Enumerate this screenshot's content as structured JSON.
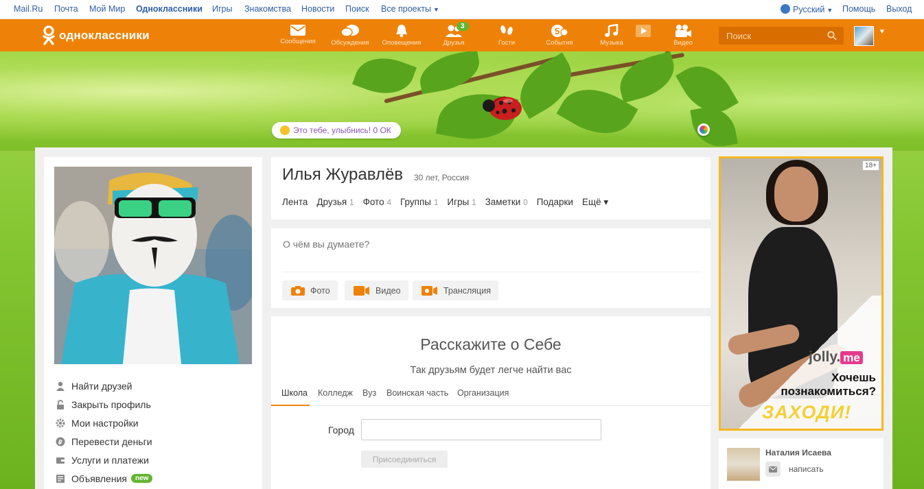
{
  "portal": {
    "links": [
      "Mail.Ru",
      "Почта",
      "Мой Мир",
      "Одноклассники",
      "Игры",
      "Знакомства",
      "Новости",
      "Поиск",
      "Все проекты"
    ],
    "language": "Русский",
    "help": "Помощь",
    "logout": "Выход"
  },
  "toolbar": {
    "logo_text": "одноклассники",
    "nav": [
      {
        "label": "Сообщения",
        "icon": "envelope-icon"
      },
      {
        "label": "Обсуждения",
        "icon": "chat-bubbles-icon"
      },
      {
        "label": "Оповещения",
        "icon": "bell-icon"
      },
      {
        "label": "Друзья",
        "icon": "friends-icon",
        "badge": "3"
      },
      {
        "label": "Гости",
        "icon": "footprints-icon"
      },
      {
        "label": "События",
        "icon": "events-icon"
      },
      {
        "label": "Музыка",
        "icon": "music-note-icon"
      },
      {
        "label": "Видео",
        "icon": "video-camera-icon"
      }
    ],
    "search_placeholder": "Поиск"
  },
  "banner": {
    "status_text": "Это тебе, улыбнись! 0 ОК"
  },
  "profile": {
    "name": "Илья Журавлёв",
    "meta": "30 лет, Россия",
    "tabs": [
      {
        "label": "Лента",
        "count": ""
      },
      {
        "label": "Друзья",
        "count": "1"
      },
      {
        "label": "Фото",
        "count": "4"
      },
      {
        "label": "Группы",
        "count": "1"
      },
      {
        "label": "Игры",
        "count": "1"
      },
      {
        "label": "Заметки",
        "count": "0"
      },
      {
        "label": "Подарки",
        "count": ""
      },
      {
        "label": "Ещё ▾",
        "count": ""
      }
    ]
  },
  "left_menu": [
    {
      "label": "Найти друзей",
      "icon": "person-icon"
    },
    {
      "label": "Закрыть профиль",
      "icon": "lock-icon"
    },
    {
      "label": "Мои настройки",
      "icon": "gear-icon"
    },
    {
      "label": "Перевести деньги",
      "icon": "ruble-icon"
    },
    {
      "label": "Услуги и платежи",
      "icon": "wallet-icon"
    },
    {
      "label": "Объявления",
      "icon": "ads-icon",
      "badge": "new"
    }
  ],
  "post": {
    "placeholder": "О чём вы думаете?",
    "buttons": [
      {
        "label": "Фото",
        "icon": "camera-icon"
      },
      {
        "label": "Видео",
        "icon": "video-icon"
      },
      {
        "label": "Трансляция",
        "icon": "broadcast-icon"
      }
    ]
  },
  "about": {
    "title": "Расскажите о Себе",
    "subtitle": "Так друзьям будет легче найти вас",
    "tabs": [
      "Школа",
      "Колледж",
      "Вуз",
      "Воинская часть",
      "Организация"
    ],
    "city_label": "Город",
    "join_label": "Присоединиться"
  },
  "ad": {
    "age": "18+",
    "brand": "jolly",
    "brand_suffix": "me",
    "question": "Хочешь познакомиться?",
    "cta": "ЗАХОДИ!"
  },
  "friend_suggest": {
    "name": "Наталия Исаева",
    "action": "написать"
  },
  "colors": {
    "brand_orange": "#ee8208",
    "link_blue": "#2d5ea5",
    "badge_green": "#63b531",
    "status_purple": "#8c55b2"
  }
}
